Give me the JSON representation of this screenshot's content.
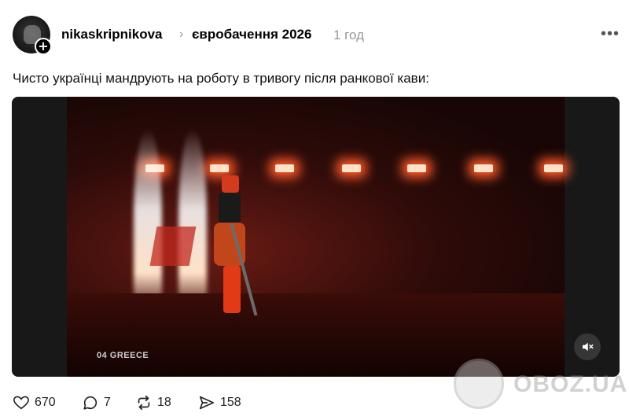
{
  "post": {
    "username": "nikaskripnikova",
    "community": "євробачення 2026",
    "time": "1 год",
    "more_icon": "more-horizontal-icon",
    "caption": "Чисто українці мандрують на роботу в тривогу після ранкової кави:"
  },
  "media": {
    "video_label": "04 GREECE",
    "mute_icon": "volume-off-icon"
  },
  "watermark": {
    "text": "OBOZ.UA"
  },
  "actions": {
    "likes": "670",
    "comments": "7",
    "reposts": "18",
    "shares": "158"
  },
  "colors": {
    "accent": "#000000",
    "muted_text": "#999999"
  }
}
